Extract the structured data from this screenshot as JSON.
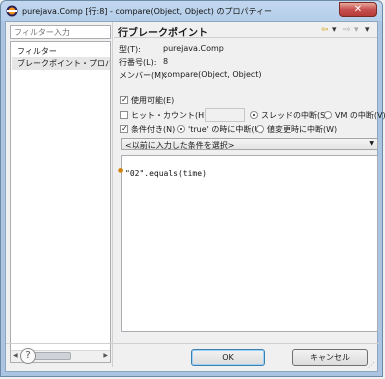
{
  "window": {
    "title": "purejava.Comp [行:8] - compare(Object, Object) のプロパティー",
    "close_glyph": "✕"
  },
  "sidebar": {
    "filter_placeholder": "フィルター入力",
    "items": [
      {
        "label": "フィルター",
        "selected": false
      },
      {
        "label": "ブレークポイント・プロパティ",
        "selected": true
      }
    ]
  },
  "page": {
    "title": "行ブレークポイント",
    "nav": {
      "back": "⇦",
      "forward": "⇨",
      "menu": "▾"
    }
  },
  "details": {
    "type_label": "型(T):",
    "type_value": "purejava.Comp",
    "line_label": "行番号(L):",
    "line_value": "8",
    "member_label": "メンバー(M):",
    "member_value": "compare(Object, Object)"
  },
  "options": {
    "enabled_label": "使用可能(E)",
    "enabled": true,
    "hit_count_label": "ヒット・カウント(H):",
    "hit_count": false,
    "hit_count_value": "",
    "suspend_thread_label": "スレッドの中断(S)",
    "suspend_thread": true,
    "suspend_vm_label": "VM の中断(V)",
    "suspend_vm": false,
    "conditional_label": "条件付き(N)",
    "conditional": true,
    "when_true_label": "'true' の時に中断(U)",
    "when_true": true,
    "when_changed_label": "値変更時に中断(W)",
    "when_changed": false,
    "condition_combo": "<以前に入力した条件を選択>"
  },
  "editor": {
    "code": "\"02\".equals(time)"
  },
  "buttons": {
    "help": "?",
    "ok": "OK",
    "cancel": "キャンセル"
  },
  "colors": {
    "title_bar": "#b4cde9",
    "close_button": "#c75050",
    "default_button_border": "#3c7fb1"
  }
}
